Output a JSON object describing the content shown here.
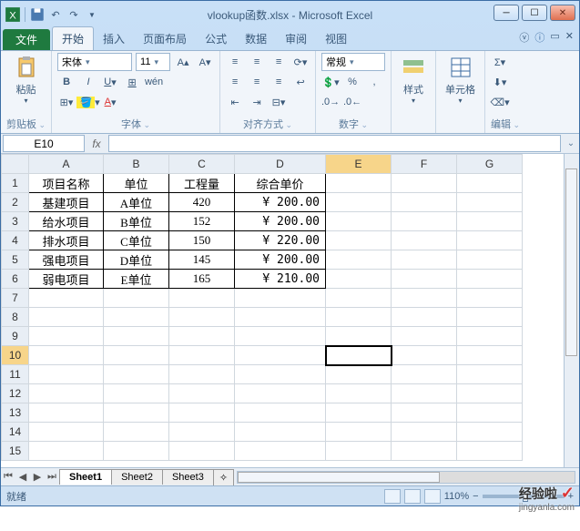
{
  "window": {
    "title": "vlookup函数.xlsx - Microsoft Excel"
  },
  "qat": {
    "excel_icon": "X",
    "save": "💾",
    "undo": "↶",
    "redo": "↷"
  },
  "tabs": {
    "file": "文件",
    "home": "开始",
    "insert": "插入",
    "page_layout": "页面布局",
    "formulas": "公式",
    "data": "数据",
    "review": "审阅",
    "view": "视图"
  },
  "ribbon": {
    "clipboard": {
      "label": "剪贴板",
      "paste": "粘贴"
    },
    "font": {
      "label": "字体",
      "name": "宋体",
      "size": "11"
    },
    "alignment": {
      "label": "对齐方式"
    },
    "number": {
      "label": "数字",
      "format": "常规"
    },
    "styles": {
      "label": "样式",
      "btn": "样式"
    },
    "cells": {
      "label": "单元格",
      "btn": "单元格"
    },
    "editing": {
      "label": "编辑"
    }
  },
  "namebox": "E10",
  "columns": [
    "A",
    "B",
    "C",
    "D",
    "E",
    "F",
    "G"
  ],
  "rows": [
    "1",
    "2",
    "3",
    "4",
    "5",
    "6",
    "7",
    "8",
    "9",
    "10",
    "11",
    "12",
    "13",
    "14",
    "15"
  ],
  "active_row": "10",
  "active_col": "E",
  "headers": {
    "c1": "项目名称",
    "c2": "单位",
    "c3": "工程量",
    "c4": "综合单价"
  },
  "chart_data": {
    "type": "table",
    "columns": [
      "项目名称",
      "单位",
      "工程量",
      "综合单价"
    ],
    "rows": [
      {
        "项目名称": "基建项目",
        "单位": "A单位",
        "工程量": 420,
        "综合单价": 200.0
      },
      {
        "项目名称": "给水项目",
        "单位": "B单位",
        "工程量": 152,
        "综合单价": 200.0
      },
      {
        "项目名称": "排水项目",
        "单位": "C单位",
        "工程量": 150,
        "综合单价": 220.0
      },
      {
        "项目名称": "强电项目",
        "单位": "D单位",
        "工程量": 145,
        "综合单价": 200.0
      },
      {
        "项目名称": "弱电项目",
        "单位": "E单位",
        "工程量": 165,
        "综合单价": 210.0
      }
    ]
  },
  "table": [
    {
      "name": "基建项目",
      "unit": "A单位",
      "qty": "420",
      "price": "¥  200.00"
    },
    {
      "name": "给水项目",
      "unit": "B单位",
      "qty": "152",
      "price": "¥  200.00"
    },
    {
      "name": "排水项目",
      "unit": "C单位",
      "qty": "150",
      "price": "¥  220.00"
    },
    {
      "name": "强电项目",
      "unit": "D单位",
      "qty": "145",
      "price": "¥  200.00"
    },
    {
      "name": "弱电项目",
      "unit": "E单位",
      "qty": "165",
      "price": "¥  210.00"
    }
  ],
  "sheets": {
    "s1": "Sheet1",
    "s2": "Sheet2",
    "s3": "Sheet3"
  },
  "status": {
    "ready": "就绪",
    "zoom": "110%"
  },
  "watermark": {
    "text": "经验啦",
    "sub": "jingyanla.com"
  }
}
